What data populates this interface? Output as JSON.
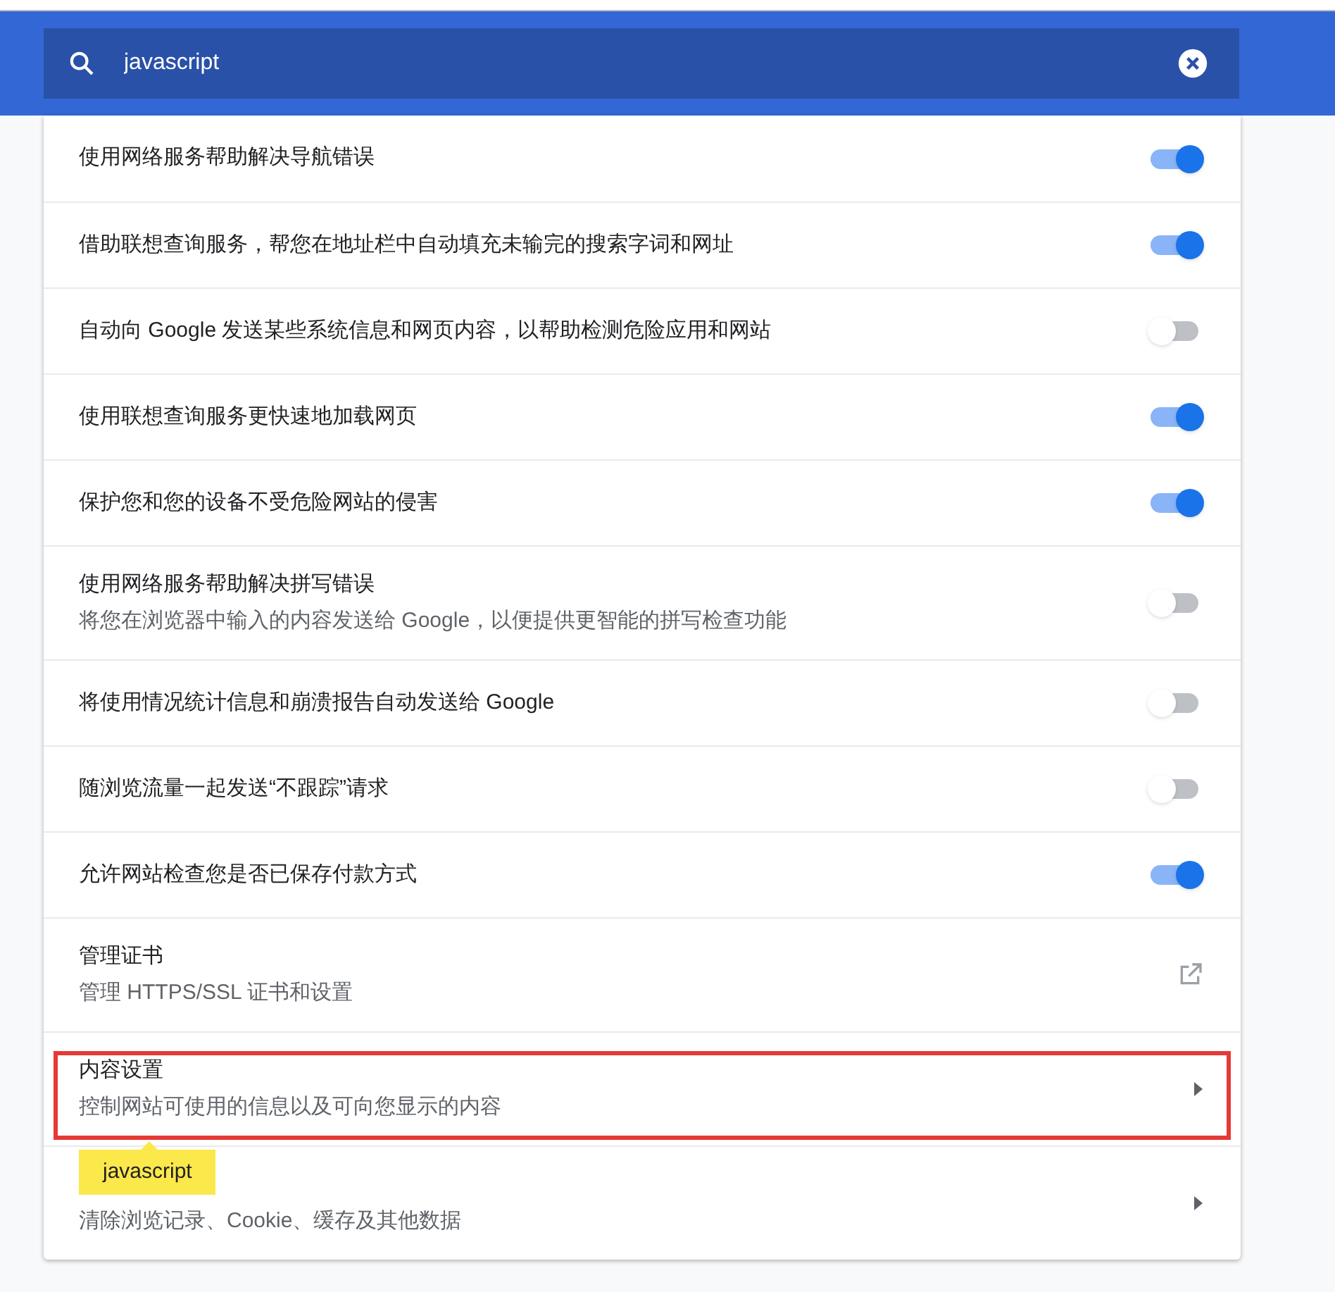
{
  "search": {
    "value": "javascript"
  },
  "rows": [
    {
      "kind": "toggle",
      "title": "使用网络服务帮助解决导航错误",
      "on": true
    },
    {
      "kind": "toggle",
      "title": "借助联想查询服务，帮您在地址栏中自动填充未输完的搜索字词和网址",
      "on": true
    },
    {
      "kind": "toggle",
      "title": "自动向 Google 发送某些系统信息和网页内容，以帮助检测危险应用和网站",
      "on": false
    },
    {
      "kind": "toggle",
      "title": "使用联想查询服务更快速地加载网页",
      "on": true
    },
    {
      "kind": "toggle",
      "title": "保护您和您的设备不受危险网站的侵害",
      "on": true
    },
    {
      "kind": "toggle",
      "title": "使用网络服务帮助解决拼写错误",
      "subtitle": "将您在浏览器中输入的内容发送给 Google，以便提供更智能的拼写检查功能",
      "on": false
    },
    {
      "kind": "toggle",
      "title": "将使用情况统计信息和崩溃报告自动发送给 Google",
      "on": false
    },
    {
      "kind": "toggle",
      "title": "随浏览流量一起发送“不跟踪”请求",
      "on": false
    },
    {
      "kind": "toggle",
      "title": "允许网站检查您是否已保存付款方式",
      "on": true
    },
    {
      "kind": "external",
      "title": "管理证书",
      "subtitle": "管理 HTTPS/SSL 证书和设置"
    },
    {
      "kind": "arrow",
      "title": "内容设置",
      "subtitle": "控制网站可使用的信息以及可向您显示的内容",
      "highlighted": true
    },
    {
      "kind": "arrow",
      "subtitle": "清除浏览记录、Cookie、缓存及其他数据",
      "tooltip": "javascript"
    }
  ]
}
